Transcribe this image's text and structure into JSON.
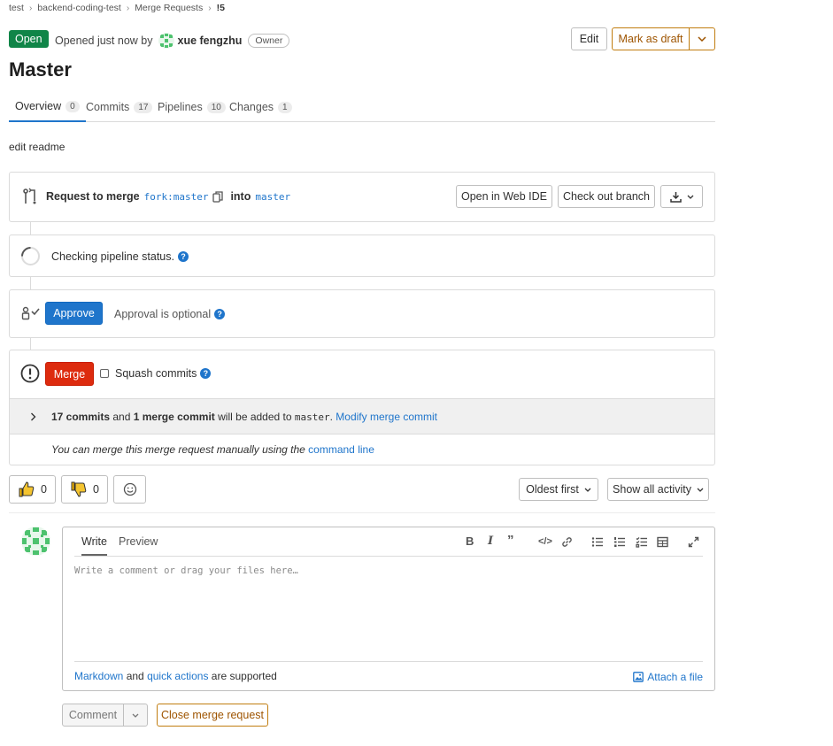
{
  "breadcrumb": [
    "test",
    "backend-coding-test",
    "Merge Requests",
    "!5"
  ],
  "header": {
    "status": "Open",
    "opened_text": "Opened just now by",
    "author": "xue fengzhu",
    "role": "Owner",
    "edit_label": "Edit",
    "draft_label": "Mark as draft"
  },
  "title": "Master",
  "tabs": [
    {
      "label": "Overview",
      "count": "0"
    },
    {
      "label": "Commits",
      "count": "17"
    },
    {
      "label": "Pipelines",
      "count": "10"
    },
    {
      "label": "Changes",
      "count": "1"
    }
  ],
  "description": "edit readme",
  "merge_request": {
    "request_label": "Request to merge",
    "source_branch": "fork:master",
    "into_label": "into",
    "target_branch": "master",
    "web_ide_label": "Open in Web IDE",
    "checkout_label": "Check out branch"
  },
  "pipeline": {
    "status_text": "Checking pipeline status."
  },
  "approval": {
    "approve_label": "Approve",
    "optional_text": "Approval is optional"
  },
  "merge": {
    "merge_label": "Merge",
    "squash_label": "Squash commits",
    "commits_count": "17 commits",
    "and_text": "and",
    "merge_commit_count": "1 merge commit",
    "added_text": "will be added to",
    "target": "master",
    "modify_label": "Modify merge commit",
    "manual_text": "You can merge this merge request manually using the",
    "command_line_label": "command line"
  },
  "reactions": {
    "thumbs_up": "0",
    "thumbs_down": "0"
  },
  "activity": {
    "sort_label": "Oldest first",
    "filter_label": "Show all activity"
  },
  "comment": {
    "write_tab": "Write",
    "preview_tab": "Preview",
    "placeholder": "Write a comment or drag your files here…",
    "markdown_label": "Markdown",
    "and_text": "and",
    "quick_actions_label": "quick actions",
    "supported_text": "are supported",
    "attach_label": "Attach a file",
    "comment_button": "Comment",
    "close_button": "Close merge request"
  },
  "colors": {
    "open": "#108548",
    "primary": "#1f75cb",
    "danger": "#dd2b0e",
    "warning": "#c17d10",
    "avatar": "#4dc26e"
  }
}
